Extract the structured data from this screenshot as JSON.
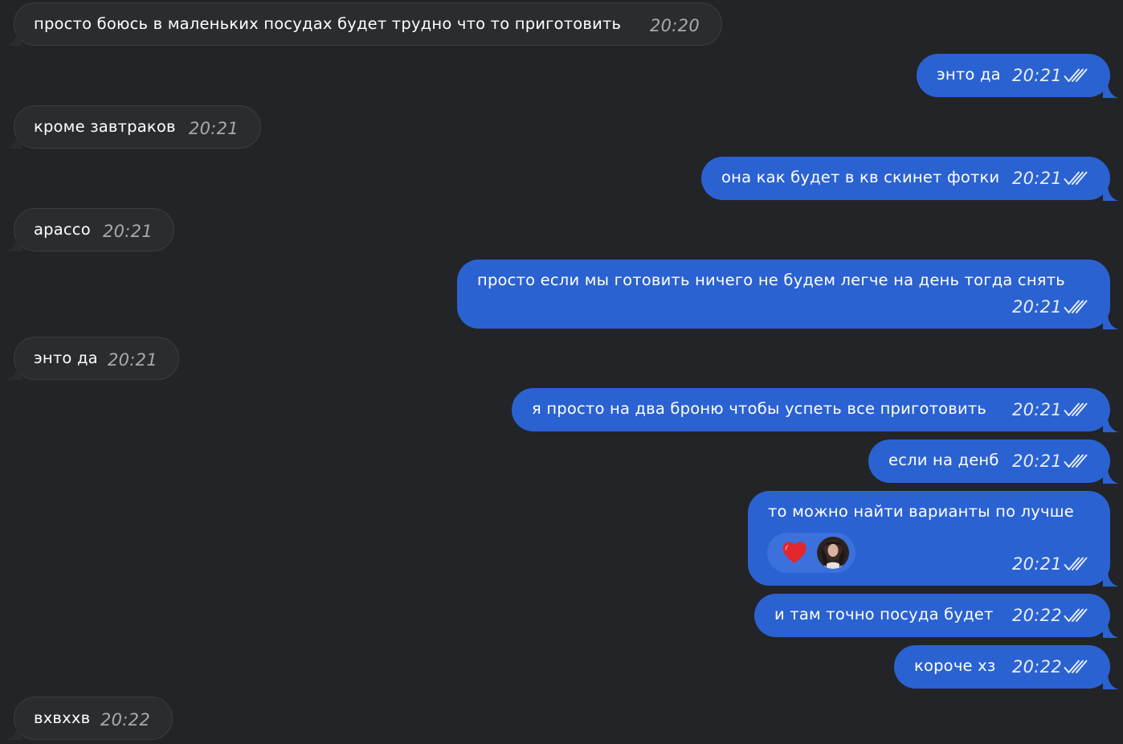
{
  "messages": [
    {
      "text": "просто боюсь в маленьких посудах будет трудно что то приготовить",
      "time": "20:20"
    },
    {
      "text": "энто да",
      "time": "20:21"
    },
    {
      "text": "кроме завтраков",
      "time": "20:21"
    },
    {
      "text": "она как будет в кв скинет фотки",
      "time": "20:21"
    },
    {
      "text": "арассо",
      "time": "20:21"
    },
    {
      "text": "просто если мы готовить ничего не будем легче на день тогда снять",
      "time": "20:21"
    },
    {
      "text": "энто да",
      "time": "20:21"
    },
    {
      "text": "я просто на два броню чтобы успеть все приготовить",
      "time": "20:21"
    },
    {
      "text": "если на денб",
      "time": "20:21"
    },
    {
      "text": "то можно найти варианты по лучше",
      "time": "20:21",
      "reaction": "heart"
    },
    {
      "text": "и там точно посуда будет",
      "time": "20:22"
    },
    {
      "text": "короче хз",
      "time": "20:22"
    },
    {
      "text": "вхвххв",
      "time": "20:22"
    }
  ],
  "colors": {
    "background": "#222427",
    "incoming_bubble": "#2b2c2f",
    "outgoing_bubble": "#2b62d1",
    "reaction_pill": "#3c70dc",
    "heart": "#e3262b"
  },
  "icons": {
    "read_status": "double-check-icon",
    "reaction": "heart-icon",
    "reactor": "avatar"
  }
}
